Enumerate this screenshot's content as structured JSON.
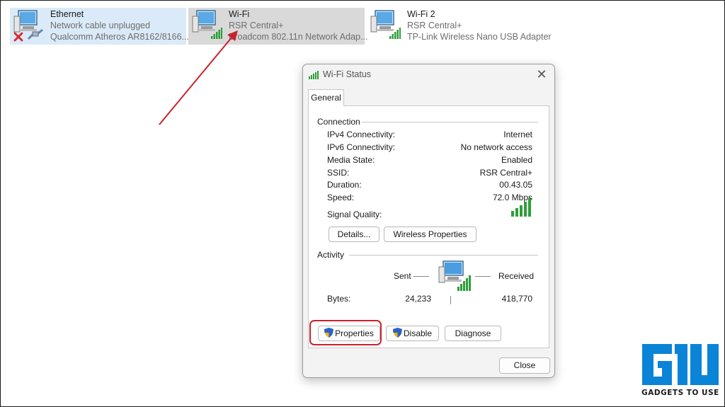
{
  "adapters": [
    {
      "name": "Ethernet",
      "status": "Network cable unplugged",
      "device": "Qualcomm Atheros AR8162/8166..."
    },
    {
      "name": "Wi-Fi",
      "status": "RSR Central+",
      "device": "Broadcom 802.11n Network Adap..."
    },
    {
      "name": "Wi-Fi 2",
      "status": "RSR Central+",
      "device": "TP-Link Wireless Nano USB Adapter"
    }
  ],
  "dialog": {
    "title": "Wi-Fi Status",
    "tab": "General",
    "connection": {
      "label": "Connection",
      "rows": [
        {
          "label": "IPv4 Connectivity:",
          "value": "Internet"
        },
        {
          "label": "IPv6 Connectivity:",
          "value": "No network access"
        },
        {
          "label": "Media State:",
          "value": "Enabled"
        },
        {
          "label": "SSID:",
          "value": "RSR Central+"
        },
        {
          "label": "Duration:",
          "value": "00.43.05"
        },
        {
          "label": "Speed:",
          "value": "72.0 Mbps"
        }
      ],
      "signal_label": "Signal Quality:",
      "signal_bars": 5
    },
    "buttons": {
      "details": "Details...",
      "wireless_properties": "Wireless Properties",
      "properties": "Properties",
      "disable": "Disable",
      "diagnose": "Diagnose",
      "close": "Close"
    },
    "activity": {
      "label": "Activity",
      "sent": "Sent",
      "received": "Received",
      "bytes_label": "Bytes:",
      "bytes_sent": "24,233",
      "bytes_received": "418,770"
    }
  },
  "logo": {
    "text": "GADGETS TO USE"
  },
  "colors": {
    "accent_red": "#c8232c",
    "signal_green": "#2e9e3a",
    "logo_blue": "#0a84d6"
  }
}
